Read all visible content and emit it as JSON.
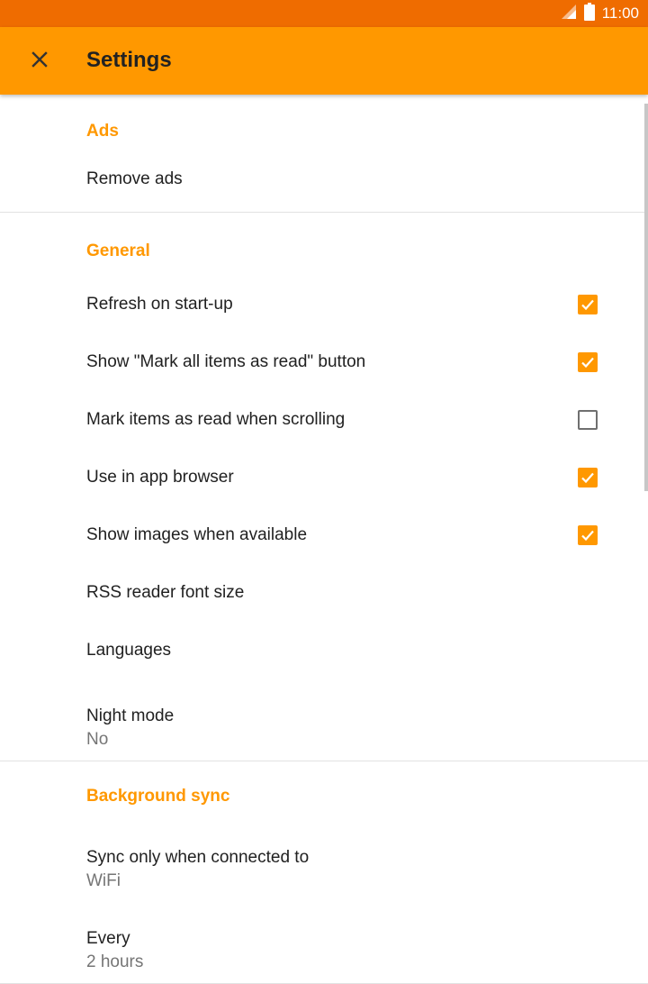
{
  "status_bar": {
    "time": "11:00"
  },
  "app_bar": {
    "title": "Settings",
    "close_icon": "close-icon"
  },
  "sections": {
    "ads": {
      "header": "Ads",
      "items": [
        {
          "label": "Remove ads"
        }
      ]
    },
    "general": {
      "header": "General",
      "items": [
        {
          "label": "Refresh on start-up",
          "checked": true
        },
        {
          "label": "Show \"Mark all items as read\" button",
          "checked": true
        },
        {
          "label": "Mark items as read when scrolling",
          "checked": false
        },
        {
          "label": "Use in app browser",
          "checked": true
        },
        {
          "label": "Show images when available",
          "checked": true
        },
        {
          "label": "RSS reader font size"
        },
        {
          "label": "Languages"
        },
        {
          "label": "Night mode",
          "summary": "No"
        }
      ]
    },
    "background_sync": {
      "header": "Background sync",
      "items": [
        {
          "label": "Sync only when connected to",
          "summary": "WiFi"
        },
        {
          "label": "Every",
          "summary": "2 hours"
        }
      ]
    }
  },
  "colors": {
    "accent": "#ff9800",
    "status_bar": "#ef6c00",
    "text_primary": "#212121",
    "text_secondary": "#757575"
  }
}
